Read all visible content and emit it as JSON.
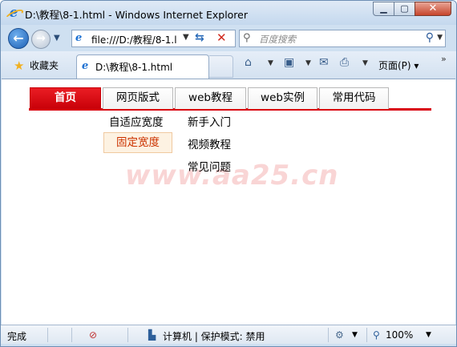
{
  "window": {
    "title": "D:\\教程\\8-1.html - Windows Internet Explorer",
    "minimize_icon": "minimize-icon",
    "maximize_icon": "maximize-icon",
    "close_icon": "close-icon"
  },
  "address_bar": {
    "value": "file:///D:/教程/8-1.l",
    "search_placeholder": "百度搜索"
  },
  "command_bar": {
    "favorites_label": "收藏夹",
    "tab_label": "D:\\教程\\8-1.html",
    "page_menu_label": "页面(P) ▾",
    "more_label": "»"
  },
  "page": {
    "menu_items": [
      {
        "label": "首页",
        "active": true
      },
      {
        "label": "网页版式",
        "active": false
      },
      {
        "label": "web教程",
        "active": false
      },
      {
        "label": "web实例",
        "active": false
      },
      {
        "label": "常用代码",
        "active": false
      }
    ],
    "submenu_left": [
      "自适应宽度",
      "固定宽度"
    ],
    "submenu_right": [
      "新手入门",
      "视频教程",
      "常见问题"
    ],
    "watermark": "www.aa25.cn",
    "accent_color": "#d9000e"
  },
  "status_bar": {
    "status_text": "完成",
    "zone_text": "计算机 | 保护模式: 禁用",
    "zoom_text": "100%"
  }
}
